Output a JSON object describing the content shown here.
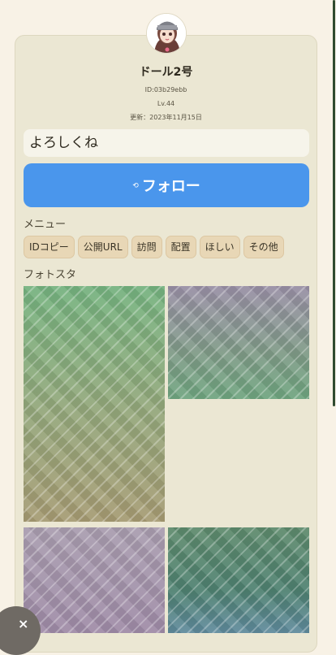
{
  "profile": {
    "name": "ドール2号",
    "id_text": "ID:03b29ebb",
    "level_text": "Lv.44",
    "updated_text": "更新：2023年11月15日",
    "greeting": "よろしくね"
  },
  "follow": {
    "label": "フォロー",
    "icon": "follow-icon"
  },
  "menu": {
    "title": "メニュー",
    "items": [
      "IDコピー",
      "公開URL",
      "訪問",
      "配置",
      "ほしい",
      "その他"
    ]
  },
  "photos": {
    "title": "フォトスタ"
  },
  "fab": {
    "label": "×",
    "icon": "close-icon"
  },
  "colors": {
    "follow_button": "#4a96ec",
    "card_background": "#ebe7d3",
    "chip_background": "#e8d7b6"
  }
}
